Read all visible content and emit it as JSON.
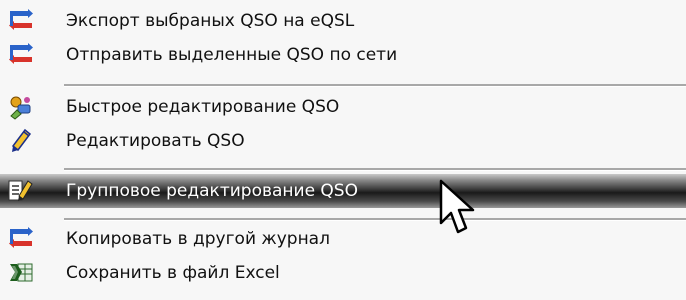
{
  "menu": {
    "items": [
      {
        "label": "Экспорт выбраных QSO на eQSL",
        "icon": "transfer-arrows-icon",
        "active": false
      },
      {
        "label": "Отправить выделенные QSO по сети",
        "icon": "transfer-arrows-icon",
        "active": false
      },
      {
        "label": "Быстрое редактирование QSO",
        "icon": "quick-edit-icon",
        "active": false
      },
      {
        "label": "Редактировать QSO",
        "icon": "pencil-icon",
        "active": false
      },
      {
        "label": "Групповое редактирование QSO",
        "icon": "group-edit-icon",
        "active": true
      },
      {
        "label": "Копировать в другой журнал",
        "icon": "transfer-arrows-icon",
        "active": false
      },
      {
        "label": "Сохранить в файл Excel",
        "icon": "excel-icon",
        "active": false
      }
    ]
  },
  "colors": {
    "menu_background": "#f7f7f7",
    "highlight_dark": "#1a1a1a",
    "highlight_text": "#ffffff"
  }
}
